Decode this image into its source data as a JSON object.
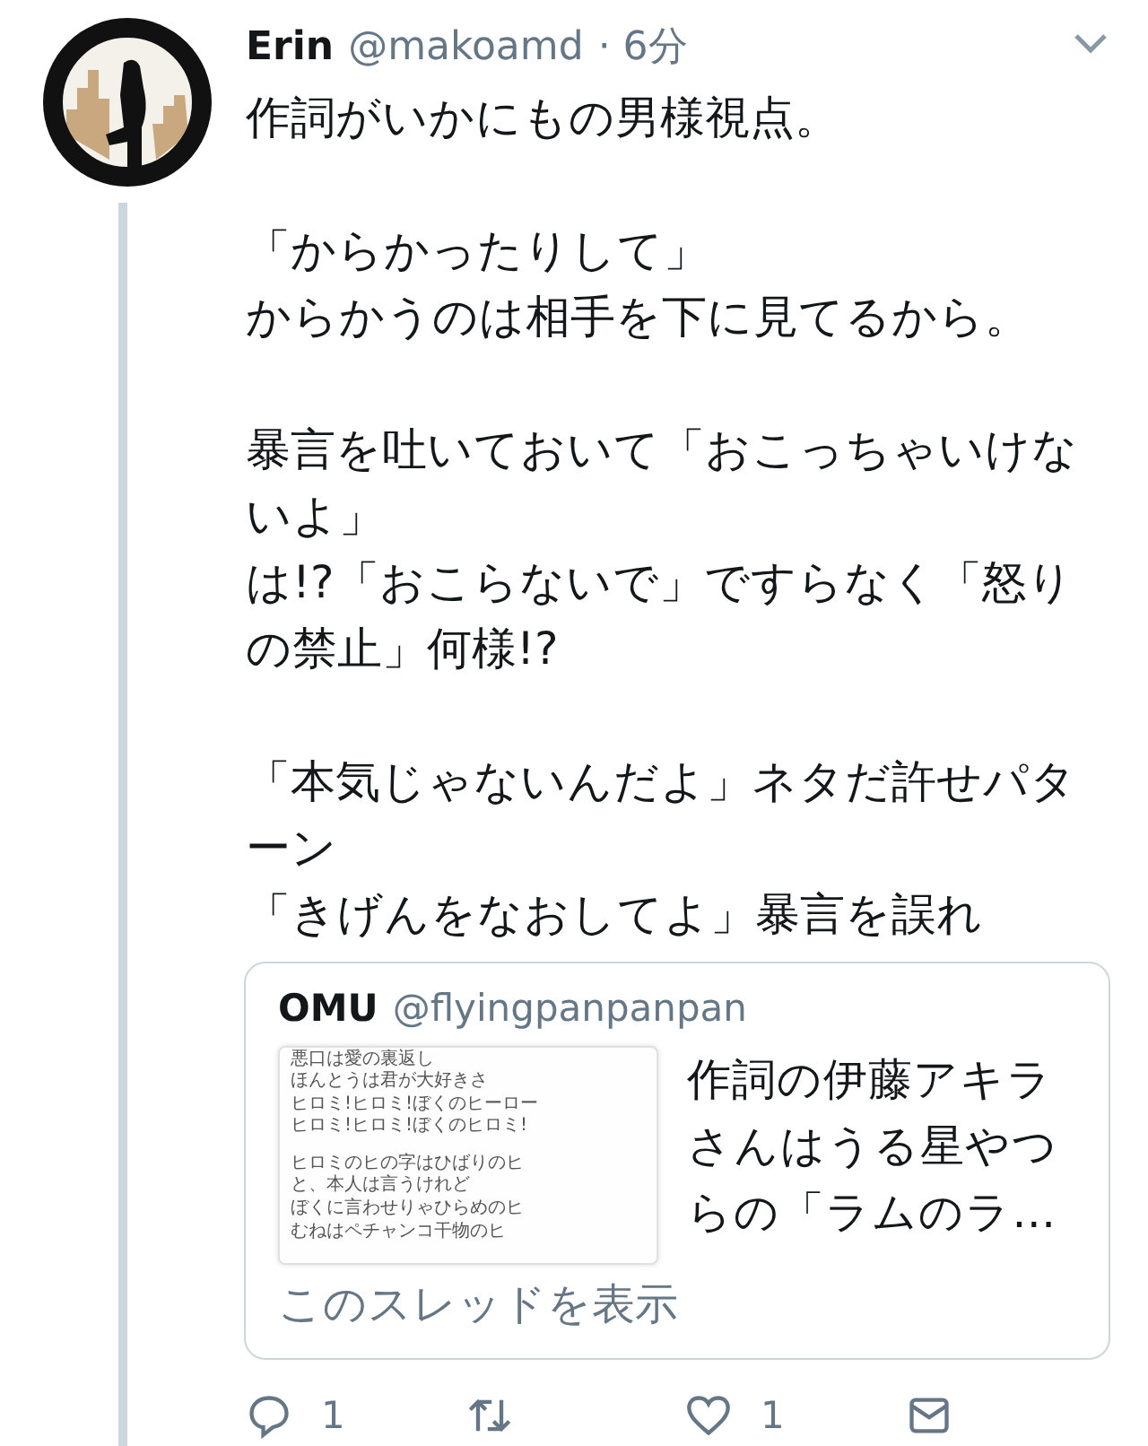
{
  "tweet": {
    "name": "Erin",
    "handle": "@makoamd",
    "time": "· 6分",
    "paragraphs": [
      [
        "作詞がいかにもの男様視点。"
      ],
      [
        "「からかったりして」",
        "からかうのは相手を下に見てるから。"
      ],
      [
        "暴言を吐いておいて「おこっちゃいけないよ」",
        "は!?「おこらないで」ですらなく「怒りの禁止」何様!?"
      ],
      [
        "「本気じゃないんだよ」ネタだ許せパターン",
        "「きげんをなおしてよ」暴言を誤れ"
      ]
    ],
    "quote": {
      "name": "OMU",
      "handle": "@flyingpanpanpan",
      "image_stanzas": [
        [
          "悪口は愛の裏返し",
          "ほんとうは君が大好きさ",
          "ヒロミ!ヒロミ!ぼくのヒーロー",
          "ヒロミ!ヒロミ!ぼくのヒロミ!"
        ],
        [
          "ヒロミのヒの字はひばりのヒ",
          "と、本人は言うけれど",
          "ぼくに言わせりゃひらめのヒ",
          "むねはペチャンコ干物のヒ"
        ]
      ],
      "text": "作詞の伊藤アキラさんはうる星やつらの「ラムのラ…"
    },
    "show_thread": "このスレッドを表示",
    "actions": [
      {
        "kind": "reply",
        "count": "1"
      },
      {
        "kind": "retweet"
      },
      {
        "kind": "like",
        "count": "1"
      },
      {
        "kind": "message"
      }
    ]
  }
}
